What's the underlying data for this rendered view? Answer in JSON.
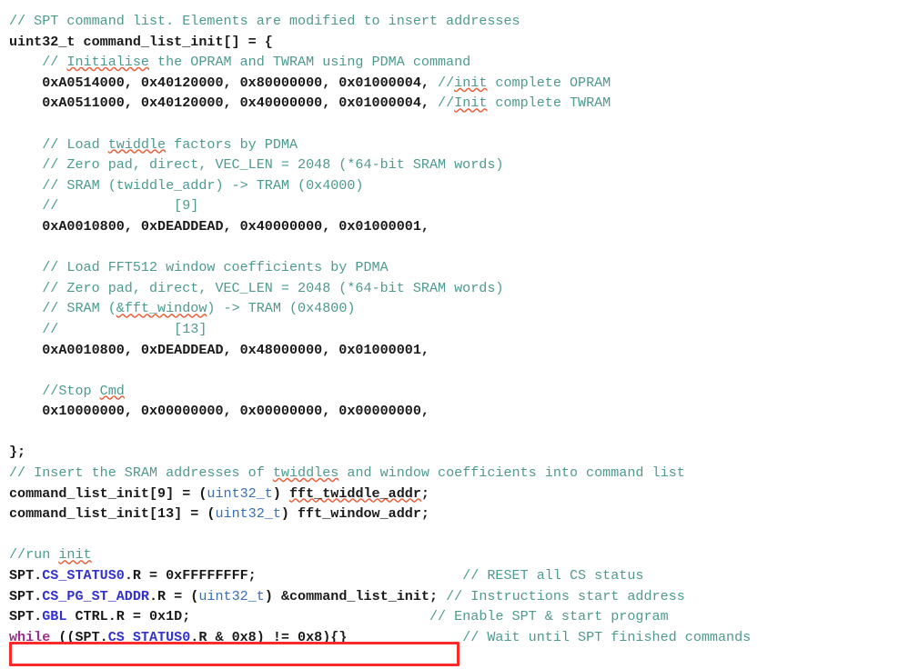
{
  "editor": {
    "language": "c",
    "background_color": "#ffffff",
    "colors": {
      "comment": "#4e9a8f",
      "plain": "#1a1a1a",
      "type": "#3b6fb5",
      "field": "#3333cc",
      "keyword": "#9b2d8f",
      "highlight_box": "#fc2b2b",
      "spellcheck_underline": "#e8603c"
    },
    "annotation": {
      "name": "red-rectangle-highlight",
      "target_line_index": 31,
      "target_text": "while ((SPT.CS_STATUS0.R & 0x8) != 0x8){}"
    }
  },
  "lines": [
    {
      "index": 0,
      "tokens": [
        {
          "t": "// SPT command list. Elements are modified to insert addresses",
          "c": "comment"
        }
      ]
    },
    {
      "index": 1,
      "tokens": [
        {
          "t": "uint32_t command_list_init[] = {",
          "c": "plain"
        }
      ]
    },
    {
      "index": 2,
      "tokens": [
        {
          "t": "    // ",
          "c": "comment"
        },
        {
          "t": "Initialise",
          "c": "comment",
          "spell": true
        },
        {
          "t": " the OPRAM and TWRAM using PDMA command",
          "c": "comment"
        }
      ]
    },
    {
      "index": 3,
      "tokens": [
        {
          "t": "    0xA0514000, 0x40120000, 0x80000000, 0x01000004, ",
          "c": "num"
        },
        {
          "t": "//",
          "c": "comment"
        },
        {
          "t": "init",
          "c": "comment",
          "spell": true
        },
        {
          "t": " complete OPRAM",
          "c": "comment"
        }
      ]
    },
    {
      "index": 4,
      "tokens": [
        {
          "t": "    0xA0511000, 0x40120000, 0x40000000, 0x01000004, ",
          "c": "num"
        },
        {
          "t": "//",
          "c": "comment"
        },
        {
          "t": "Init",
          "c": "comment",
          "spell": true
        },
        {
          "t": " complete TWRAM",
          "c": "comment"
        }
      ]
    },
    {
      "index": 5,
      "tokens": [
        {
          "t": "",
          "c": "plain"
        }
      ]
    },
    {
      "index": 6,
      "tokens": [
        {
          "t": "    // Load ",
          "c": "comment"
        },
        {
          "t": "twiddle",
          "c": "comment",
          "spell": true
        },
        {
          "t": " factors by PDMA",
          "c": "comment"
        }
      ]
    },
    {
      "index": 7,
      "tokens": [
        {
          "t": "    // Zero pad, direct, VEC_LEN = 2048 (*64-bit SRAM words)",
          "c": "comment"
        }
      ]
    },
    {
      "index": 8,
      "tokens": [
        {
          "t": "    // SRAM (twiddle_addr) -> TRAM (0x4000)",
          "c": "comment"
        }
      ]
    },
    {
      "index": 9,
      "tokens": [
        {
          "t": "    //              [9]",
          "c": "comment"
        }
      ]
    },
    {
      "index": 10,
      "tokens": [
        {
          "t": "    0xA0010800, 0xDEADDEAD, 0x40000000, 0x01000001,",
          "c": "num"
        }
      ]
    },
    {
      "index": 11,
      "tokens": [
        {
          "t": "",
          "c": "plain"
        }
      ]
    },
    {
      "index": 12,
      "tokens": [
        {
          "t": "    // Load FFT512 window coefficients by PDMA",
          "c": "comment"
        }
      ]
    },
    {
      "index": 13,
      "tokens": [
        {
          "t": "    // Zero pad, direct, VEC_LEN = 2048 (*64-bit SRAM words)",
          "c": "comment"
        }
      ]
    },
    {
      "index": 14,
      "tokens": [
        {
          "t": "    // SRAM (",
          "c": "comment"
        },
        {
          "t": "&fft_window",
          "c": "comment",
          "spell": true
        },
        {
          "t": ") -> TRAM (0x4800)",
          "c": "comment"
        }
      ]
    },
    {
      "index": 15,
      "tokens": [
        {
          "t": "    //              [13]",
          "c": "comment"
        }
      ]
    },
    {
      "index": 16,
      "tokens": [
        {
          "t": "    0xA0010800, 0xDEADDEAD, 0x48000000, 0x01000001,",
          "c": "num"
        }
      ]
    },
    {
      "index": 17,
      "tokens": [
        {
          "t": "",
          "c": "plain"
        }
      ]
    },
    {
      "index": 18,
      "tokens": [
        {
          "t": "    //Stop ",
          "c": "comment"
        },
        {
          "t": "Cmd",
          "c": "comment",
          "spell": true
        }
      ]
    },
    {
      "index": 19,
      "tokens": [
        {
          "t": "    0x10000000, 0x00000000, 0x00000000, 0x00000000,",
          "c": "num"
        }
      ]
    },
    {
      "index": 20,
      "tokens": [
        {
          "t": "",
          "c": "plain"
        }
      ]
    },
    {
      "index": 21,
      "tokens": [
        {
          "t": "};",
          "c": "plain"
        }
      ]
    },
    {
      "index": 22,
      "tokens": [
        {
          "t": "// Insert the SRAM addresses of ",
          "c": "comment"
        },
        {
          "t": "twiddles",
          "c": "comment",
          "spell": true
        },
        {
          "t": " and window coefficients into command list",
          "c": "comment"
        }
      ]
    },
    {
      "index": 23,
      "tokens": [
        {
          "t": "command_list_init[9] = (",
          "c": "plain"
        },
        {
          "t": "uint32_t",
          "c": "type"
        },
        {
          "t": ") ",
          "c": "plain"
        },
        {
          "t": "fft_twiddle_addr",
          "c": "plain",
          "spell": true
        },
        {
          "t": ";",
          "c": "plain"
        }
      ]
    },
    {
      "index": 24,
      "tokens": [
        {
          "t": "command_list_init[13] = (",
          "c": "plain"
        },
        {
          "t": "uint32_t",
          "c": "type"
        },
        {
          "t": ") fft_window_addr;",
          "c": "plain"
        }
      ]
    },
    {
      "index": 25,
      "tokens": [
        {
          "t": "",
          "c": "plain"
        }
      ]
    },
    {
      "index": 26,
      "tokens": [
        {
          "t": "//run ",
          "c": "comment"
        },
        {
          "t": "init",
          "c": "comment",
          "spell": true
        }
      ]
    },
    {
      "index": 27,
      "tokens": [
        {
          "t": "SPT.",
          "c": "plain"
        },
        {
          "t": "CS_STATUS0",
          "c": "field"
        },
        {
          "t": ".R = 0xFFFFFFFF;",
          "c": "plain"
        },
        {
          "t": "                         ",
          "c": "plain"
        },
        {
          "t": "// RESET all CS status",
          "c": "comment"
        }
      ]
    },
    {
      "index": 28,
      "tokens": [
        {
          "t": "SPT.",
          "c": "plain"
        },
        {
          "t": "CS_PG_ST_ADDR",
          "c": "field"
        },
        {
          "t": ".R = (",
          "c": "plain"
        },
        {
          "t": "uint32_t",
          "c": "type"
        },
        {
          "t": ") &command_list_init; ",
          "c": "plain"
        },
        {
          "t": "// Instructions start address",
          "c": "comment"
        }
      ]
    },
    {
      "index": 29,
      "tokens": [
        {
          "t": "SPT.",
          "c": "plain"
        },
        {
          "t": "GBL",
          "c": "field"
        },
        {
          "t": " CTRL.R = 0x1D;",
          "c": "plain"
        },
        {
          "t": "                             ",
          "c": "plain"
        },
        {
          "t": "// Enable SPT & start program",
          "c": "comment"
        }
      ]
    },
    {
      "index": 30,
      "tokens": [
        {
          "t": "while",
          "c": "keyword"
        },
        {
          "t": " ((SPT.",
          "c": "plain"
        },
        {
          "t": "CS_STATUS0",
          "c": "field"
        },
        {
          "t": ".R & 0x8) != 0x8){}",
          "c": "plain"
        },
        {
          "t": "              ",
          "c": "plain"
        },
        {
          "t": "// Wait until SPT finished commands",
          "c": "comment"
        }
      ]
    }
  ]
}
